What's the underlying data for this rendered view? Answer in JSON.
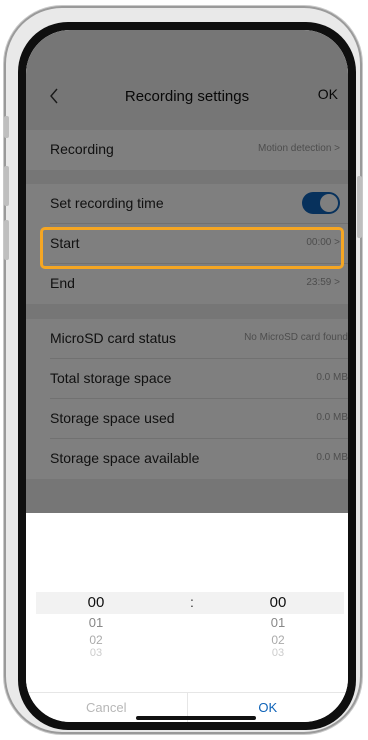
{
  "header": {
    "back_icon": "chevron-left-icon",
    "title": "Recording settings",
    "ok": "OK"
  },
  "recording": {
    "label": "Recording",
    "value": "Motion detection >"
  },
  "schedule": {
    "set_time_label": "Set recording time",
    "set_time_enabled": true,
    "start_label": "Start",
    "start_value": "00:00 >",
    "end_label": "End",
    "end_value": "23:59 >"
  },
  "storage": {
    "status_label": "MicroSD card status",
    "status_value": "No MicroSD card found",
    "total_label": "Total storage space",
    "total_value": "0.0 MB",
    "used_label": "Storage space used",
    "used_value": "0.0 MB",
    "available_label": "Storage space available",
    "available_value": "0.0 MB"
  },
  "picker": {
    "hours": [
      "00",
      "01",
      "02",
      "03"
    ],
    "separator": ":",
    "minutes": [
      "00",
      "01",
      "02",
      "03"
    ],
    "cancel": "Cancel",
    "ok": "OK"
  },
  "colors": {
    "accent": "#0e63b8",
    "highlight": "#f5a623"
  }
}
